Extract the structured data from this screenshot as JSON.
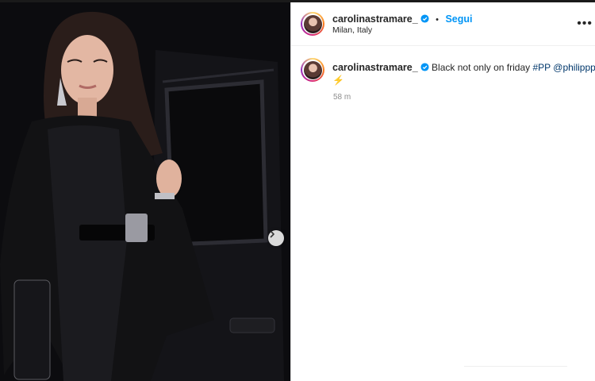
{
  "post": {
    "username": "carolinastramare_",
    "follow_label": "Segui",
    "separator": "•",
    "location": "Milan, Italy",
    "more_icon": "more-horizontal-icon",
    "verified_color": "#0095f6"
  },
  "caption": {
    "username": "carolinastramare_",
    "text": "Black not only on friday",
    "hashtag": "#PP",
    "mention": "@philippplein",
    "emoji": "⚡",
    "time": "58 m"
  },
  "media": {
    "next_icon": "chevron-right-icon"
  }
}
